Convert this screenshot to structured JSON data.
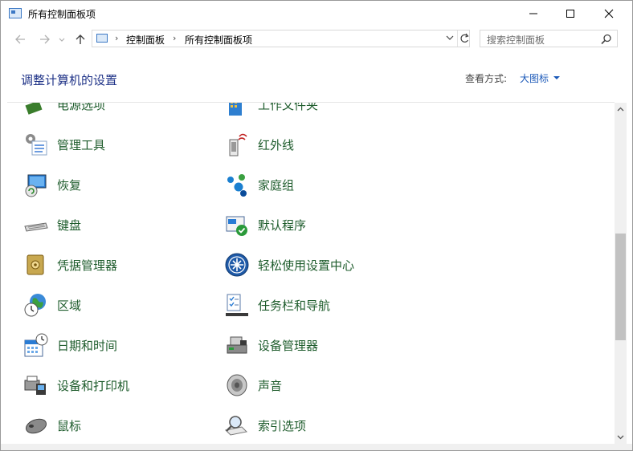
{
  "window": {
    "title": "所有控制面板项"
  },
  "nav": {
    "crumbs": [
      "控制面板",
      "所有控制面板项"
    ],
    "search_placeholder": "搜索控制面板"
  },
  "header": {
    "title": "调整计算机的设置",
    "view_label": "查看方式:",
    "view_value": "大图标"
  },
  "items": [
    {
      "label": "电源选项",
      "icon": "power-options-icon"
    },
    {
      "label": "工作文件夹",
      "icon": "work-folders-icon"
    },
    {
      "label": "管理工具",
      "icon": "admin-tools-icon"
    },
    {
      "label": "红外线",
      "icon": "infrared-icon"
    },
    {
      "label": "恢复",
      "icon": "recovery-icon"
    },
    {
      "label": "家庭组",
      "icon": "homegroup-icon"
    },
    {
      "label": "键盘",
      "icon": "keyboard-icon"
    },
    {
      "label": "默认程序",
      "icon": "default-programs-icon"
    },
    {
      "label": "凭据管理器",
      "icon": "credential-manager-icon"
    },
    {
      "label": "轻松使用设置中心",
      "icon": "ease-of-access-icon"
    },
    {
      "label": "区域",
      "icon": "region-icon"
    },
    {
      "label": "任务栏和导航",
      "icon": "taskbar-navigation-icon"
    },
    {
      "label": "日期和时间",
      "icon": "date-time-icon"
    },
    {
      "label": "设备管理器",
      "icon": "device-manager-icon"
    },
    {
      "label": "设备和打印机",
      "icon": "devices-printers-icon"
    },
    {
      "label": "声音",
      "icon": "sound-icon"
    },
    {
      "label": "鼠标",
      "icon": "mouse-icon"
    },
    {
      "label": "索引选项",
      "icon": "indexing-options-icon"
    }
  ]
}
